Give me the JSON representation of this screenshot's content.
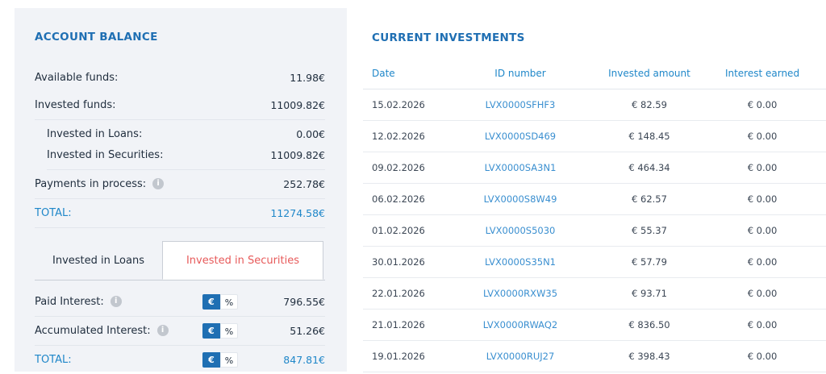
{
  "account_balance": {
    "title": "ACCOUNT BALANCE",
    "rows": [
      {
        "label": "Available funds:",
        "value": "11.98€"
      },
      {
        "label": "Invested funds:",
        "value": "11009.82€"
      },
      {
        "label": "Invested in Loans:",
        "value": "0.00€"
      },
      {
        "label": "Invested in Securities:",
        "value": "11009.82€"
      },
      {
        "label": "Payments in process:",
        "value": "252.78€"
      },
      {
        "label": "TOTAL:",
        "value": "11274.58€"
      }
    ],
    "tabs": [
      "Invested in Loans",
      "Invested in Securities"
    ],
    "interest": [
      {
        "label": "Paid Interest:",
        "value": "796.55€"
      },
      {
        "label": "Accumulated Interest:",
        "value": "51.26€"
      },
      {
        "label": "TOTAL:",
        "value": "847.81€"
      }
    ],
    "toggle": {
      "eur": "€",
      "pct": "%"
    }
  },
  "current_investments": {
    "title": "CURRENT INVESTMENTS",
    "columns": [
      "Date",
      "ID number",
      "Invested amount",
      "Interest earned"
    ],
    "rows": [
      {
        "date": "15.02.2026",
        "id": "LVX0000SFHF3",
        "invested": "€ 82.59",
        "interest": "€ 0.00"
      },
      {
        "date": "12.02.2026",
        "id": "LVX0000SD469",
        "invested": "€ 148.45",
        "interest": "€ 0.00"
      },
      {
        "date": "09.02.2026",
        "id": "LVX0000SA3N1",
        "invested": "€ 464.34",
        "interest": "€ 0.00"
      },
      {
        "date": "06.02.2026",
        "id": "LVX0000S8W49",
        "invested": "€ 62.57",
        "interest": "€ 0.00"
      },
      {
        "date": "01.02.2026",
        "id": "LVX0000S5030",
        "invested": "€ 55.37",
        "interest": "€ 0.00"
      },
      {
        "date": "30.01.2026",
        "id": "LVX0000S35N1",
        "invested": "€ 57.79",
        "interest": "€ 0.00"
      },
      {
        "date": "22.01.2026",
        "id": "LVX0000RXW35",
        "invested": "€ 93.71",
        "interest": "€ 0.00"
      },
      {
        "date": "21.01.2026",
        "id": "LVX0000RWAQ2",
        "invested": "€ 836.50",
        "interest": "€ 0.00"
      },
      {
        "date": "19.01.2026",
        "id": "LVX0000RUJ27",
        "invested": "€ 398.43",
        "interest": "€ 0.00"
      }
    ]
  }
}
